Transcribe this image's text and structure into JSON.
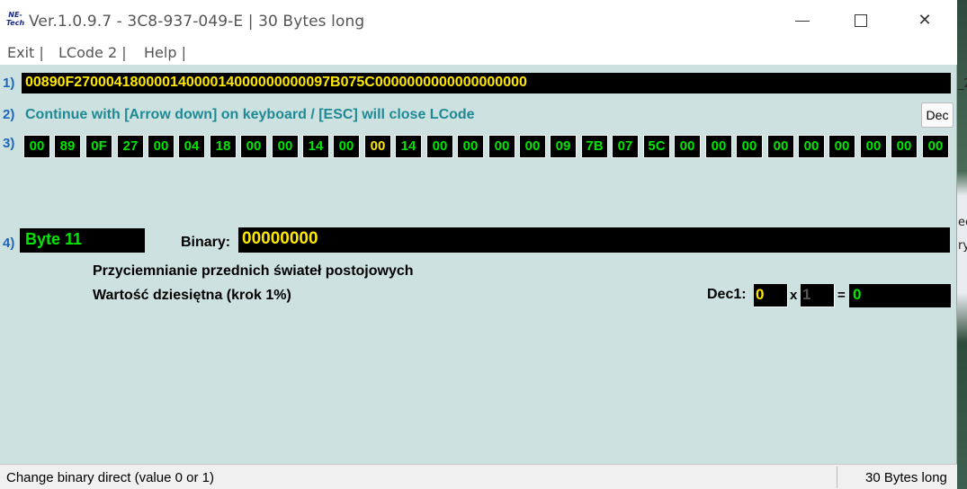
{
  "desktop": {
    "frag1": "_2",
    "frag2": "ec",
    "frag3": "ry"
  },
  "app": {
    "logo_line1": "NE-",
    "logo_line2": "Tech",
    "title": "Ver.1.0.9.7 -   3C8-937-049-E | 30 Bytes long"
  },
  "menu": {
    "exit": "Exit |",
    "lcode": "LCode 2 |",
    "help": "Help |"
  },
  "rows": {
    "r1": "1)",
    "r2": "2)",
    "r3": "3)",
    "r4": "4)"
  },
  "hex_string": "00890F27000418000014000014000000000097B075C0000000000000000000",
  "hint": "Continue with [Arrow down] on keyboard / [ESC] will close LCode",
  "dec_button": "Dec",
  "bytes": [
    "00",
    "89",
    "0F",
    "27",
    "00",
    "04",
    "18",
    "00",
    "00",
    "14",
    "00",
    "00",
    "14",
    "00",
    "00",
    "00",
    "00",
    "09",
    "7B",
    "07",
    "5C",
    "00",
    "00",
    "00",
    "00",
    "00",
    "00",
    "00",
    "00",
    "00"
  ],
  "highlight_index": 11,
  "selected_byte": "Byte 11",
  "binary_label": "Binary:",
  "binary_value": "00000000",
  "description_line1": "Przyciemnianie przednich świateł postojowych",
  "description_line2": "Wartość dziesiętna (krok 1%)",
  "dec1_label": "Dec1:",
  "dec1_value": "0",
  "multiply_sign": "x",
  "multiplier": "1",
  "equals_sign": "=",
  "result": "0",
  "status": {
    "left": "Change binary direct (value 0 or 1)",
    "right": "30 Bytes long"
  },
  "colors": {
    "background": "#cde1e1",
    "accent_green": "#00e600",
    "accent_yellow": "#ffe800",
    "row_number_blue": "#1f66b8"
  }
}
